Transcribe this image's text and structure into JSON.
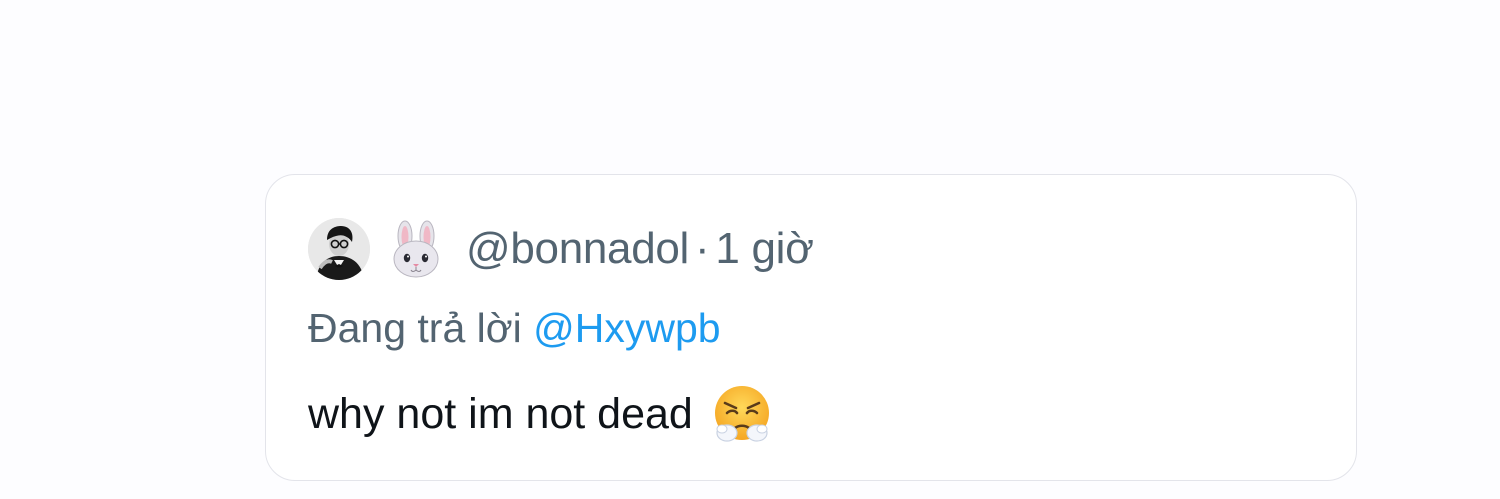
{
  "tweet": {
    "author_handle": "@bonnadol",
    "separator": "·",
    "timestamp": "1 giờ",
    "replying_prefix": "Đang trả lời",
    "replying_to": "@Hxywpb",
    "text": "why not im not dead",
    "author_emoji_icon": "rabbit-face-icon",
    "text_emoji_icon": "face-with-steam-from-nose-icon"
  },
  "colors": {
    "muted": "#536471",
    "mention": "#1d9bf0",
    "text": "#0f1419",
    "card_border": "#e3e4ea"
  }
}
